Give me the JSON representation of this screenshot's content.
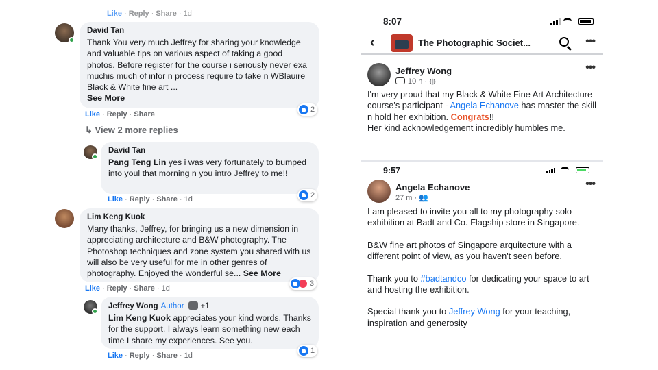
{
  "left": {
    "top_actions": {
      "like": "Like",
      "reply": "Reply",
      "share": "Share",
      "time": "1d"
    },
    "c1": {
      "name": "David Tan",
      "text": "Thank You very much Jeffrey for sharing your knowledge and valuable tips on various aspect of taking a good photos. Before register for the course i seriously never exa muchis much of infor n process require to take n WBlauire Black & White fine art ...",
      "see_more": "See More",
      "actions": {
        "like": "Like",
        "reply": "Reply",
        "share": "Share"
      },
      "reactions": "2"
    },
    "view_more": "View 2 more replies",
    "c2": {
      "name": "David Tan",
      "mention": "Pang Teng Lin",
      "text": " yes i was very fortunately to bumped into youl that morning n you intro Jeffrey to me!!",
      "actions": {
        "like": "Like",
        "reply": "Reply",
        "share": "Share",
        "time": "1d"
      },
      "reactions": "2"
    },
    "c3": {
      "name": "Lim Keng Kuok",
      "text": "Many thanks, Jeffrey, for bringing us a new dimension in appreciating architecture and B&W photography. The Photoshop techniques and zone system you shared with us will also be very useful for me in other genres of photography. Enjoyed the wonderful se...",
      "see_more": "See More",
      "actions": {
        "like": "Like",
        "reply": "Reply",
        "share": "Share",
        "time": "1d"
      },
      "reactions": "3"
    },
    "c4": {
      "name": "Jeffrey Wong",
      "author": "Author",
      "plus": "+1",
      "mention": "Lim Keng Kuok",
      "text": " appreciates your kind words. Thanks for the support. I always learn something new each time I share my experiences. See you.",
      "actions": {
        "like": "Like",
        "reply": "Reply",
        "share": "Share",
        "time": "1d"
      },
      "reactions": "1"
    }
  },
  "right": {
    "status_time": "8:07",
    "group_name": "The Photographic Societ...",
    "post1": {
      "name": "Jeffrey Wong",
      "meta": "10 h ·",
      "text_a": "I'm very proud that my Black & White Fine Art Architecture course's participant - ",
      "link": "Angela Echanove",
      "text_b": " has master the skill n hold her exhibition.  ",
      "congrats": "Congrats",
      "text_c": "!!",
      "text_d": "Her kind acknowledgement incredibly humbles me."
    },
    "status_time2": "9:57",
    "post2": {
      "name": "Angela Echanove",
      "meta": "27 m ·",
      "p1": "I am pleased to invite you all to my photography solo exhibition at Badt and Co. Flagship store in Singapore.",
      "p2": "B&W fine art photos of Singapore arquitecture with a different point of view, as you haven't seen before.",
      "p3a": "Thank you to ",
      "hashtag": "#badtandco",
      "p3b": " for dedicating your space to art and hosting the exhibition.",
      "p4a": "Special thank you to ",
      "p4link": "Jeffrey Wong",
      "p4b": " for your teaching, inspiration and generosity"
    }
  },
  "icons": [
    "back-arrow-icon",
    "search-icon",
    "more-dots-icon",
    "like-reaction-icon",
    "love-reaction-icon",
    "reply-arrow-icon",
    "globe-icon",
    "friends-icon",
    "signal-icon",
    "wifi-icon",
    "battery-icon"
  ],
  "colors": {
    "link": "#1877f2",
    "bubble": "#f0f2f5",
    "congrats": "#e8542a",
    "meta": "#65676b"
  }
}
